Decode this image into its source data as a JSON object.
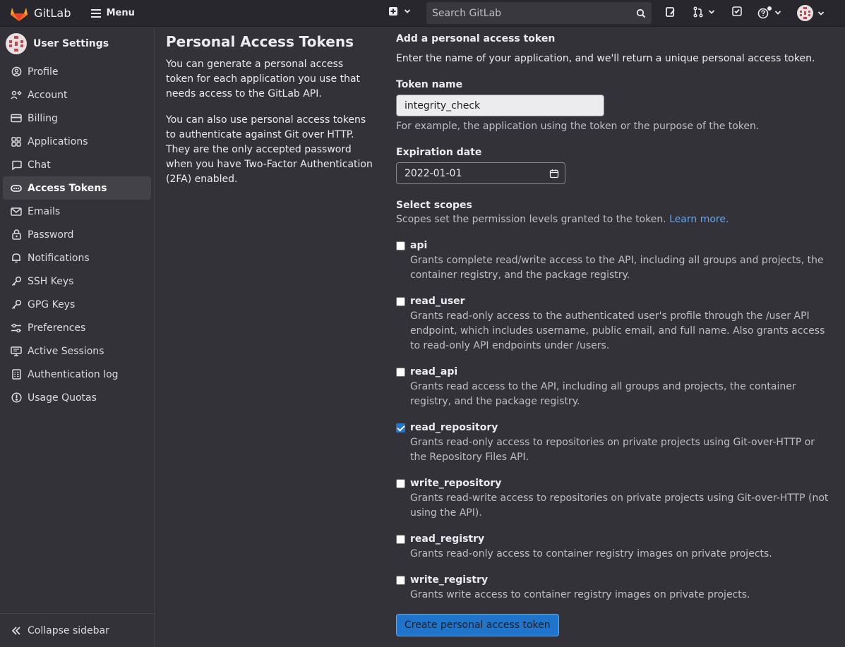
{
  "topbar": {
    "brand": "GitLab",
    "menu_label": "Menu",
    "search_placeholder": "Search GitLab"
  },
  "sidebar": {
    "title": "User Settings",
    "items": [
      {
        "label": "Profile",
        "icon": "profile-icon"
      },
      {
        "label": "Account",
        "icon": "account-icon"
      },
      {
        "label": "Billing",
        "icon": "credit-card-icon"
      },
      {
        "label": "Applications",
        "icon": "applications-icon"
      },
      {
        "label": "Chat",
        "icon": "comment-icon"
      },
      {
        "label": "Access Tokens",
        "icon": "token-icon",
        "active": true
      },
      {
        "label": "Emails",
        "icon": "mail-icon"
      },
      {
        "label": "Password",
        "icon": "lock-icon"
      },
      {
        "label": "Notifications",
        "icon": "notifications-icon"
      },
      {
        "label": "SSH Keys",
        "icon": "key-icon"
      },
      {
        "label": "GPG Keys",
        "icon": "key-icon"
      },
      {
        "label": "Preferences",
        "icon": "preferences-icon"
      },
      {
        "label": "Active Sessions",
        "icon": "monitor-icon"
      },
      {
        "label": "Authentication log",
        "icon": "log-icon"
      },
      {
        "label": "Usage Quotas",
        "icon": "quota-icon"
      }
    ],
    "collapse_label": "Collapse sidebar"
  },
  "intro": {
    "title": "Personal Access Tokens",
    "para1": "You can generate a personal access token for each application you use that needs access to the GitLab API.",
    "para2": "You can also use personal access tokens to authenticate against Git over HTTP. They are the only accepted password when you have Two-Factor Authentication (2FA) enabled."
  },
  "form": {
    "heading": "Add a personal access token",
    "description": "Enter the name of your application, and we'll return a unique personal access token.",
    "token_name_label": "Token name",
    "token_name_value": "integrity_check",
    "token_name_help": "For example, the application using the token or the purpose of the token.",
    "expiration_label": "Expiration date",
    "expiration_value": "2022-01-01",
    "scopes_label": "Select scopes",
    "scopes_help": "Scopes set the permission levels granted to the token.",
    "learn_more": "Learn more.",
    "submit_label": "Create personal access token"
  },
  "scopes": [
    {
      "name": "api",
      "checked": false,
      "desc": "Grants complete read/write access to the API, including all groups and projects, the container registry, and the package registry."
    },
    {
      "name": "read_user",
      "checked": false,
      "desc": "Grants read-only access to the authenticated user's profile through the /user API endpoint, which includes username, public email, and full name. Also grants access to read-only API endpoints under /users."
    },
    {
      "name": "read_api",
      "checked": false,
      "desc": "Grants read access to the API, including all groups and projects, the container registry, and the package registry."
    },
    {
      "name": "read_repository",
      "checked": true,
      "desc": "Grants read-only access to repositories on private projects using Git-over-HTTP or the Repository Files API."
    },
    {
      "name": "write_repository",
      "checked": false,
      "desc": "Grants read-write access to repositories on private projects using Git-over-HTTP (not using the API)."
    },
    {
      "name": "read_registry",
      "checked": false,
      "desc": "Grants read-only access to container registry images on private projects."
    },
    {
      "name": "write_registry",
      "checked": false,
      "desc": "Grants write access to container registry images on private projects."
    }
  ],
  "colors": {
    "accent": "#1f75cb",
    "link": "#63a6e9",
    "brand_orange": "#e24329"
  }
}
